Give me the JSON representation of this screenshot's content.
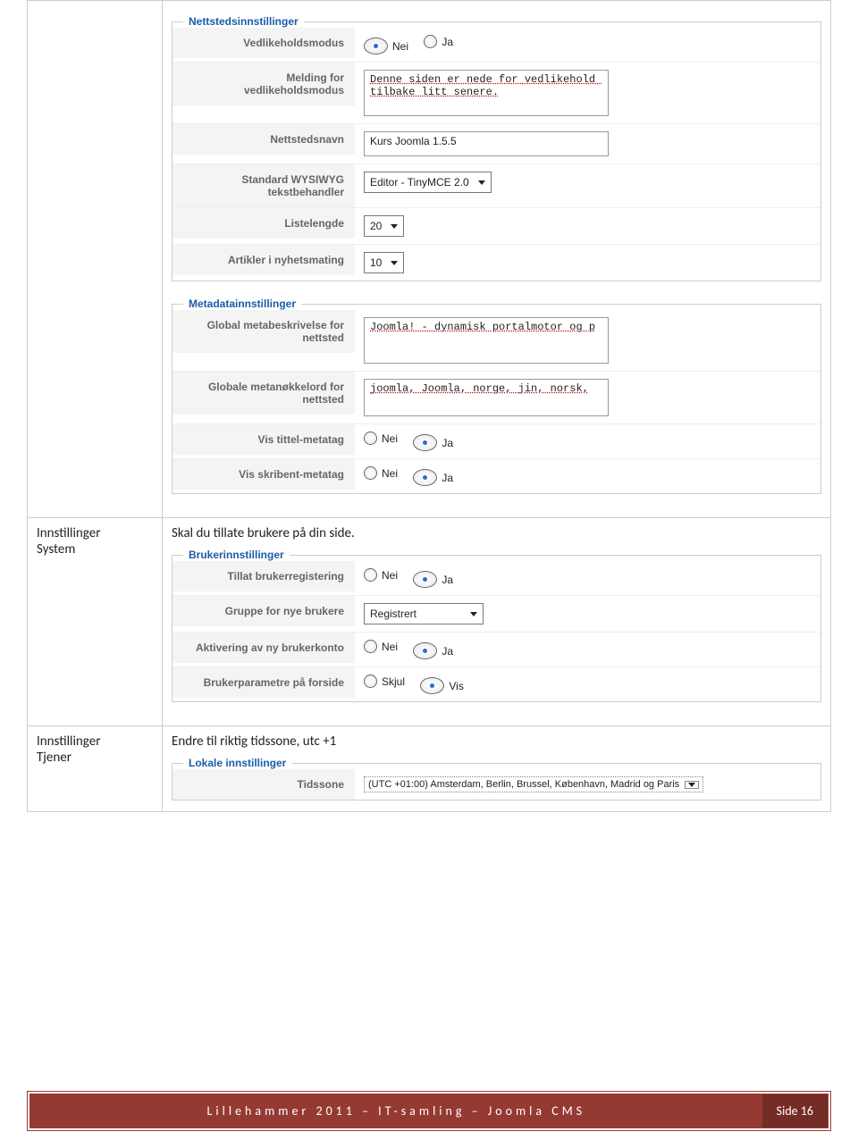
{
  "rows": [
    {
      "left": ""
    },
    {
      "left_line1": "Innstillinger",
      "left_line2": "System",
      "desc": "Skal du tillate brukere på din side."
    },
    {
      "left_line1": "Innstillinger",
      "left_line2": "Tjener",
      "desc": "Endre til riktig tidssone, utc +1"
    }
  ],
  "site_settings": {
    "legend": "Nettstedsinnstillinger",
    "maintenance_label": "Vedlikeholdsmodus",
    "maintenance_no": "Nei",
    "maintenance_yes": "Ja",
    "maintenance_selected": "Nei",
    "maintenance_msg_label": "Melding for vedlikeholdsmodus",
    "maintenance_msg_value": "Denne siden er nede for vedlikehold tilbake litt senere.",
    "sitename_label": "Nettstedsnavn",
    "sitename_value": "Kurs Joomla 1.5.5",
    "editor_label": "Standard WYSIWYG tekstbehandler",
    "editor_value": "Editor - TinyMCE 2.0",
    "listlen_label": "Listelengde",
    "listlen_value": "20",
    "feedart_label": "Artikler i nyhetsmating",
    "feedart_value": "10"
  },
  "meta_settings": {
    "legend": "Metadatainnstillinger",
    "metadesc_label": "Global metabeskrivelse for nettsted",
    "metadesc_value": "Joomla! - dynamisk portalmotor og p",
    "metakeys_label": "Globale metanøkkelord for nettsted",
    "metakeys_value": "joomla, Joomla, norge, jin, norsk,",
    "title_label": "Vis tittel-metatag",
    "author_label": "Vis skribent-metatag",
    "opt_no": "Nei",
    "opt_yes": "Ja",
    "title_selected": "Ja",
    "author_selected": "Ja"
  },
  "user_settings": {
    "legend": "Brukerinnstillinger",
    "reg_label": "Tillat brukerregistering",
    "group_label": "Gruppe for nye brukere",
    "group_value": "Registrert",
    "activate_label": "Aktivering av ny brukerkonto",
    "params_label": "Brukerparametre på forside",
    "opt_no": "Nei",
    "opt_yes": "Ja",
    "opt_hide": "Skjul",
    "opt_show": "Vis",
    "reg_selected": "Ja",
    "activate_selected": "Ja",
    "params_selected": "Vis"
  },
  "locale_settings": {
    "legend": "Lokale innstillinger",
    "tz_label": "Tidssone",
    "tz_value": "(UTC +01:00) Amsterdam, Berlin, Brussel, København, Madrid og Paris"
  },
  "footer": {
    "main": "Lillehammer 2011 – IT-samling – Joomla CMS",
    "page": "Side 16"
  }
}
